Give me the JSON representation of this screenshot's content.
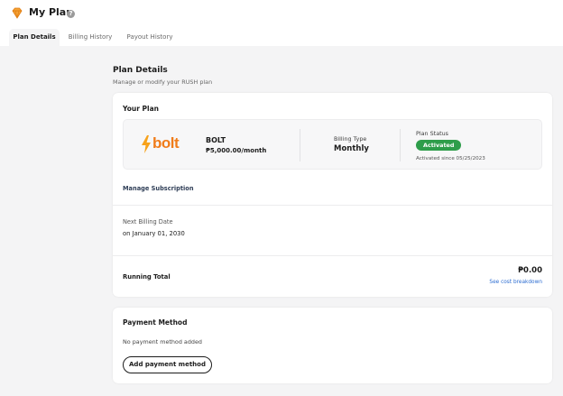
{
  "header": {
    "title": "My Plan",
    "help_glyph": "?",
    "icon": "diamond-icon"
  },
  "tabs": [
    {
      "label": "Plan Details",
      "active": true
    },
    {
      "label": "Billing History",
      "active": false
    },
    {
      "label": "Payout History",
      "active": false
    }
  ],
  "section": {
    "title": "Plan Details",
    "subtitle": "Manage or modify your RUSH plan"
  },
  "plan_card": {
    "title": "Your Plan",
    "logo_text": "bolt",
    "plan_name": "BOLT",
    "plan_price": "₱5,000.00/month",
    "billing_type_label": "Billing Type",
    "billing_type_value": "Monthly",
    "status_label": "Plan Status",
    "status_value": "Activated",
    "status_since": "Activated since 05/25/2023",
    "manage_link": "Manage Subscription",
    "next_billing_label": "Next Billing Date",
    "next_billing_value": "on January 01, 2030",
    "running_total_label": "Running Total",
    "running_total_value": "₱0.00",
    "cost_breakdown_link": "See cost breakdown"
  },
  "payment_card": {
    "title": "Payment Method",
    "empty_text": "No payment method added",
    "add_button": "Add payment method"
  },
  "colors": {
    "brand_orange": "#f07c1a",
    "status_green": "#2e9d4a",
    "link_blue": "#2b6cd1"
  }
}
